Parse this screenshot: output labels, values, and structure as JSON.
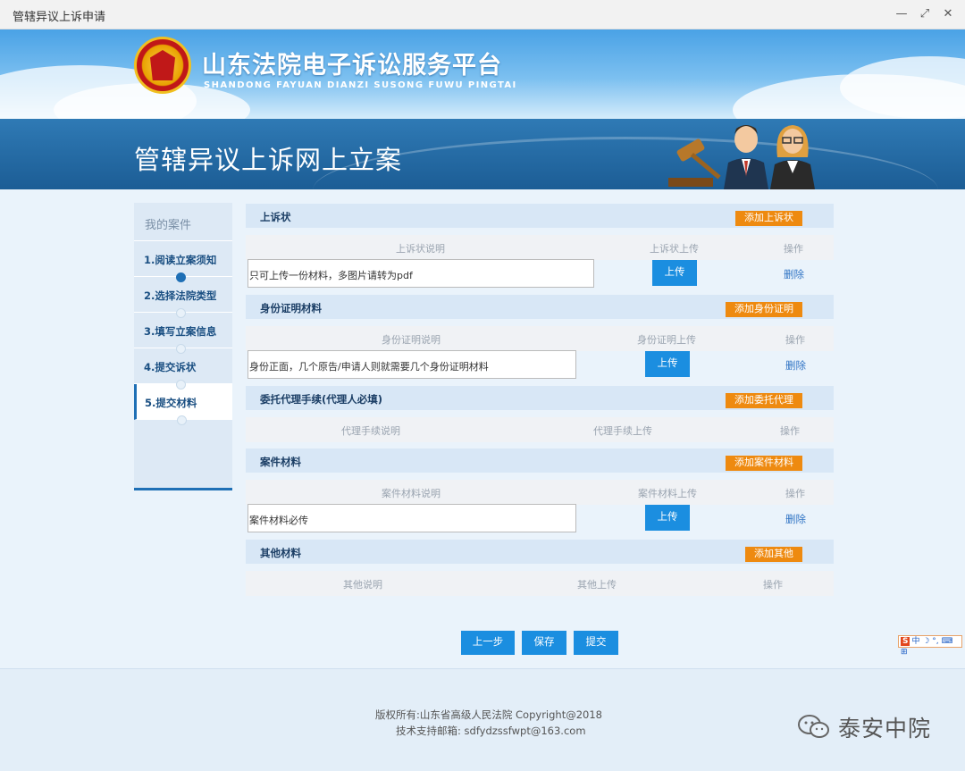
{
  "window": {
    "title": "管辖异议上诉申请"
  },
  "header": {
    "title": "山东法院电子诉讼服务平台",
    "subtitle": "SHANDONG FAYUAN DIANZI SUSONG FUWU PINGTAI"
  },
  "banner": {
    "title": "管辖异议上诉网上立案"
  },
  "sidebar": {
    "heading": "我的案件",
    "steps": [
      {
        "label": "1.阅读立案须知"
      },
      {
        "label": "2.选择法院类型"
      },
      {
        "label": "3.填写立案信息"
      },
      {
        "label": "4.提交诉状"
      },
      {
        "label": "5.提交材料"
      }
    ]
  },
  "sections": {
    "appeal": {
      "title": "上诉状",
      "add": "添加上诉状",
      "col_desc": "上诉状说明",
      "col_upload": "上诉状上传",
      "col_op": "操作",
      "desc": "只可上传一份材料，多图片请转为pdf",
      "upload": "上传",
      "delete": "删除"
    },
    "identity": {
      "title": "身份证明材料",
      "add": "添加身份证明",
      "col_desc": "身份证明说明",
      "col_upload": "身份证明上传",
      "col_op": "操作",
      "desc": "身份正面，几个原告/申请人则就需要几个身份证明材料",
      "upload": "上传",
      "delete": "删除"
    },
    "proxy": {
      "title": "委托代理手续(代理人必填)",
      "add": "添加委托代理",
      "col_desc": "代理手续说明",
      "col_upload": "代理手续上传",
      "col_op": "操作"
    },
    "case": {
      "title": "案件材料",
      "add": "添加案件材料",
      "col_desc": "案件材料说明",
      "col_upload": "案件材料上传",
      "col_op": "操作",
      "desc": "案件材料必传",
      "upload": "上传",
      "delete": "删除"
    },
    "other": {
      "title": "其他材料",
      "add": "添加其他",
      "col_desc": "其他说明",
      "col_upload": "其他上传",
      "col_op": "操作"
    }
  },
  "actions": {
    "prev": "上一步",
    "save": "保存",
    "submit": "提交"
  },
  "ime": {
    "label": "中 ☽ °, ⌨ ⊞"
  },
  "footer": {
    "copyright": "版权所有:山东省高级人民法院 Copyright@2018",
    "email": "技术支持邮箱: sdfydzssfwpt@163.com"
  },
  "watermark": {
    "text": "泰安中院"
  }
}
